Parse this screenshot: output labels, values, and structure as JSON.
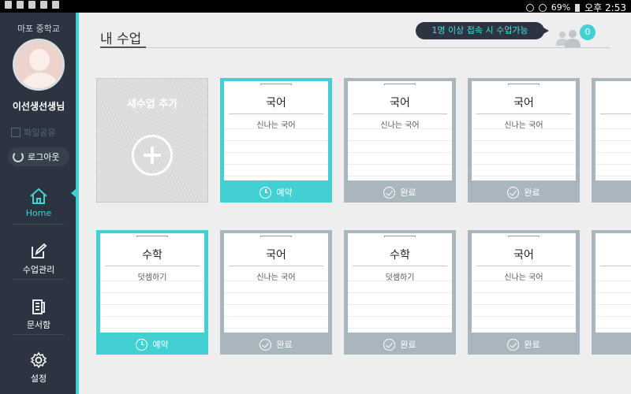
{
  "statusbar": {
    "battery": "69%",
    "time": "오후 2:53"
  },
  "sidebar": {
    "school": "마포 중학교",
    "teacher": "이선생선생님",
    "share_label": "파일공유",
    "logout_label": "로그아웃",
    "nav": [
      {
        "label": "Home",
        "icon": "home-icon"
      },
      {
        "label": "수업관리",
        "icon": "edit-icon"
      },
      {
        "label": "문서함",
        "icon": "document-icon"
      },
      {
        "label": "설정",
        "icon": "gear-icon"
      }
    ]
  },
  "header": {
    "title": "내 수업",
    "notice": "1명 이상 접속 시 수업가능",
    "user_count": "0"
  },
  "add_card": {
    "label": "새수업 추가"
  },
  "cards": [
    {
      "subject": "국어",
      "desc": "신나는 국어",
      "status": "예약"
    },
    {
      "subject": "국어",
      "desc": "신나는 국어",
      "status": "완료"
    },
    {
      "subject": "국어",
      "desc": "신나는 국어",
      "status": "완료"
    },
    {
      "subject": "수학",
      "desc": "덧셈하기",
      "status": "예약"
    },
    {
      "subject": "국어",
      "desc": "신나는 국어",
      "status": "완료"
    },
    {
      "subject": "수학",
      "desc": "덧셈하기",
      "status": "완료"
    },
    {
      "subject": "국어",
      "desc": "신나는 국어",
      "status": "완료"
    }
  ],
  "colors": {
    "accent": "#43d0d2",
    "sidebar": "#2b3440",
    "done": "#a9b6bd"
  }
}
